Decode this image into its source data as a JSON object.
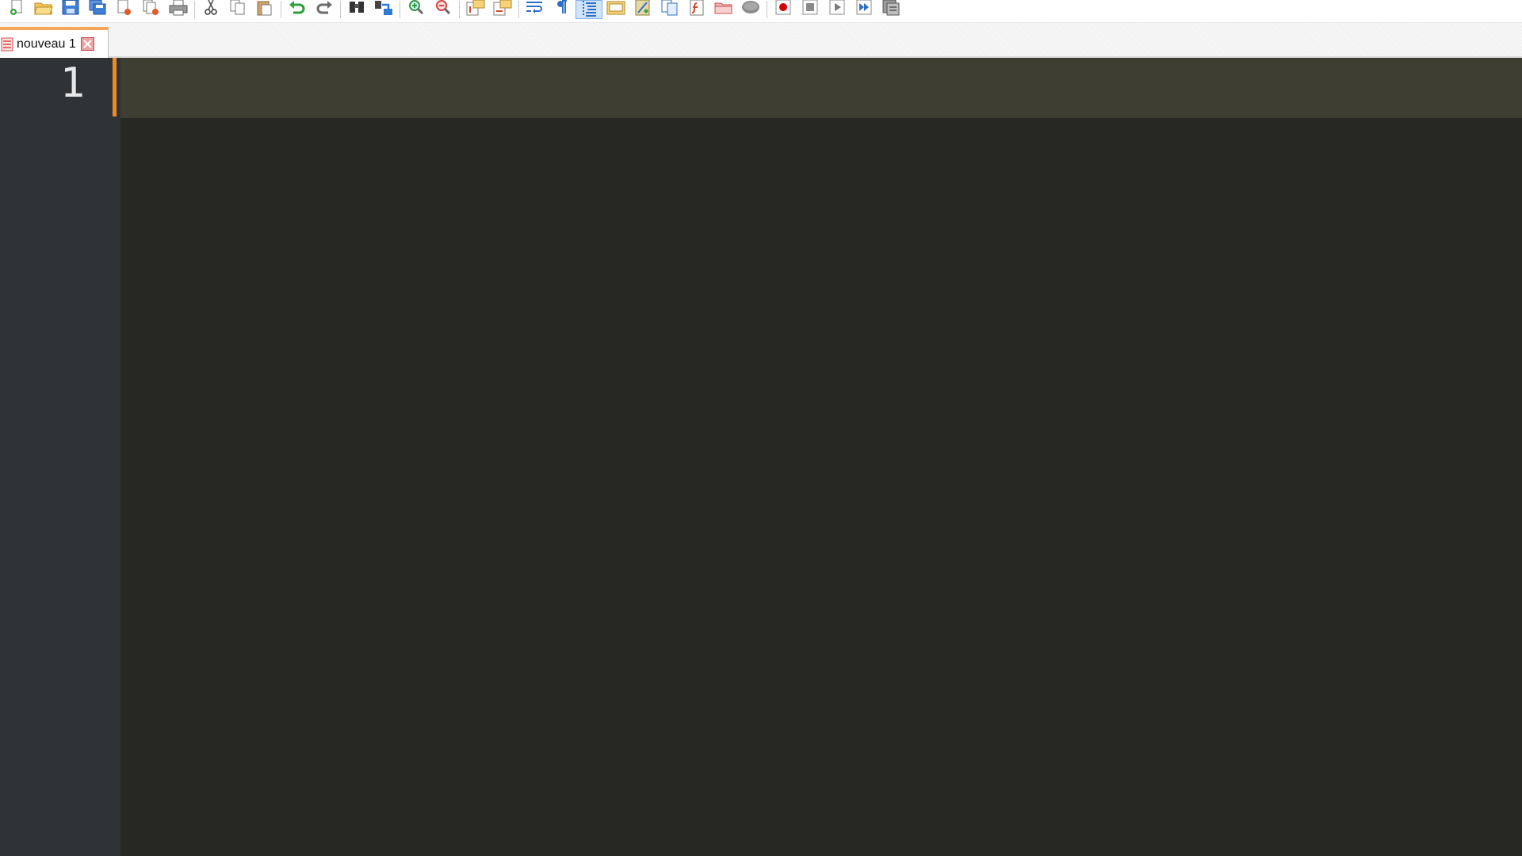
{
  "toolbar": {
    "buttons": [
      {
        "name": "new-file",
        "icon": "new-file-icon"
      },
      {
        "name": "open-file",
        "icon": "open-folder-icon"
      },
      {
        "name": "save",
        "icon": "save-icon"
      },
      {
        "name": "save-all",
        "icon": "save-all-icon"
      },
      {
        "name": "close",
        "icon": "close-file-icon"
      },
      {
        "name": "close-all",
        "icon": "close-all-icon"
      },
      {
        "name": "print",
        "icon": "printer-icon"
      },
      {
        "name": "cut",
        "icon": "scissors-icon"
      },
      {
        "name": "copy",
        "icon": "copy-icon"
      },
      {
        "name": "paste",
        "icon": "paste-icon"
      },
      {
        "name": "undo",
        "icon": "undo-icon"
      },
      {
        "name": "redo",
        "icon": "redo-icon"
      },
      {
        "name": "find",
        "icon": "binoculars-icon"
      },
      {
        "name": "replace",
        "icon": "replace-icon"
      },
      {
        "name": "zoom-in",
        "icon": "zoom-in-icon"
      },
      {
        "name": "zoom-out",
        "icon": "zoom-out-icon"
      },
      {
        "name": "sync-vertical",
        "icon": "sync-vertical-icon"
      },
      {
        "name": "sync-horizontal",
        "icon": "sync-horizontal-icon"
      },
      {
        "name": "word-wrap",
        "icon": "word-wrap-icon"
      },
      {
        "name": "show-all-chars",
        "icon": "pilcrow-icon"
      },
      {
        "name": "indent-guide",
        "icon": "indent-guide-icon"
      },
      {
        "name": "language",
        "icon": "language-icon"
      },
      {
        "name": "document-map",
        "icon": "document-map-icon"
      },
      {
        "name": "document-list",
        "icon": "document-list-icon"
      },
      {
        "name": "function-list",
        "icon": "function-list-icon"
      },
      {
        "name": "folder-as-workspace",
        "icon": "folder-workspace-icon"
      },
      {
        "name": "monitoring",
        "icon": "monitoring-icon"
      },
      {
        "name": "record-macro",
        "icon": "record-icon"
      },
      {
        "name": "stop-recording",
        "icon": "stop-icon"
      },
      {
        "name": "play-macro",
        "icon": "play-icon"
      },
      {
        "name": "run-macro-multiple",
        "icon": "fast-forward-icon"
      },
      {
        "name": "save-macro",
        "icon": "save-macro-icon"
      }
    ]
  },
  "tabs": [
    {
      "label": "nouveau 1",
      "active": true
    }
  ],
  "editor": {
    "line_numbers": [
      "1"
    ],
    "text": ""
  },
  "colors": {
    "editor_bg": "#272822",
    "current_line_bg": "#3e3d32",
    "gutter_bg": "#2f3336",
    "fold_margin": "#f08a24",
    "tab_accent": "#f5a65b"
  }
}
